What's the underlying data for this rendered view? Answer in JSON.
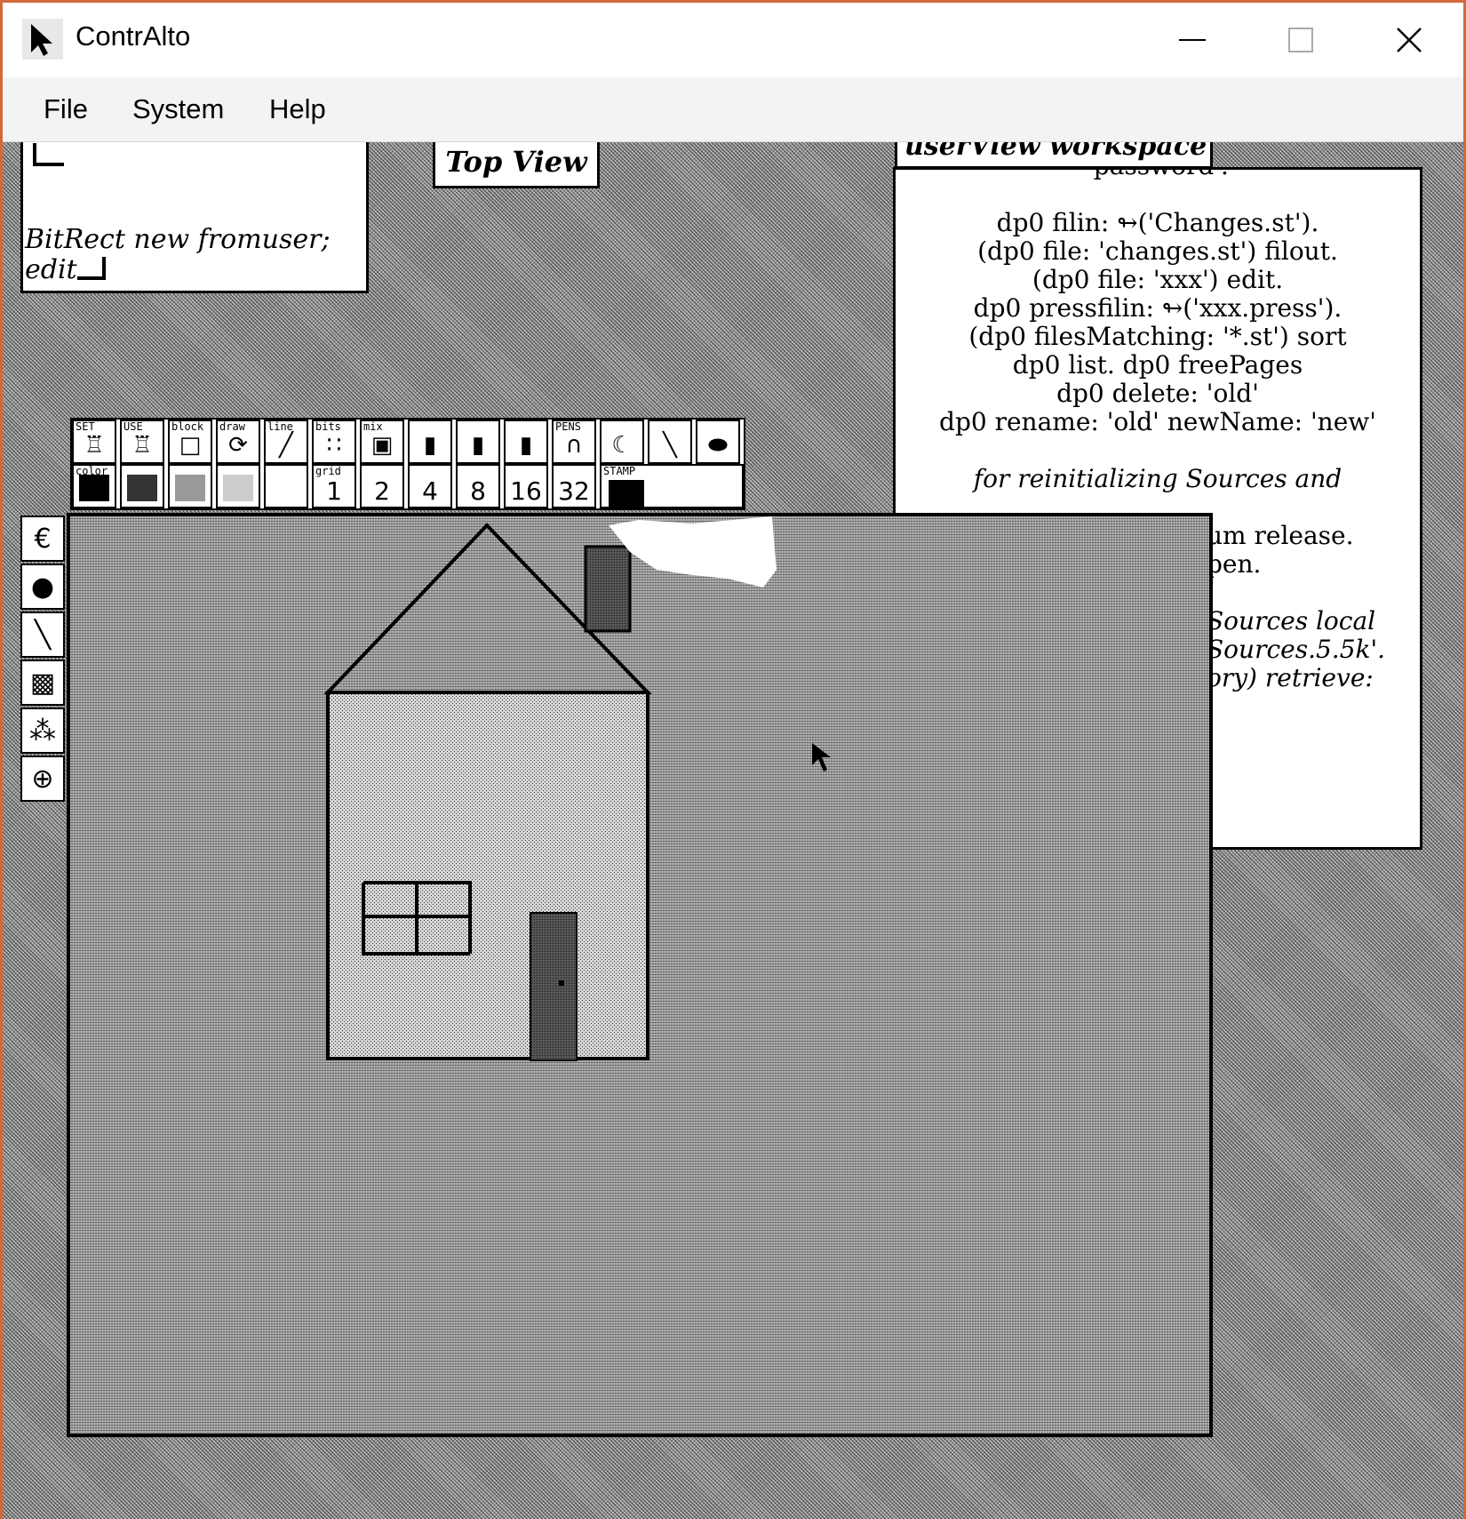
{
  "window": {
    "title": "ContrAlto",
    "border_color": "#d2693a"
  },
  "menu": {
    "items": [
      "File",
      "System",
      "Help"
    ]
  },
  "alto": {
    "small_window": {
      "line1": "BitRect new fromuser;",
      "line2": "edit"
    },
    "top_view_label": "Top View",
    "workspace": {
      "title": "userView workspace",
      "lines": [
        "'password'.",
        "",
        "dp0 filin: ↬('Changes.st').",
        "(dp0 file: 'changes.st') filout.",
        "(dp0 file: 'xxx') edit.",
        "dp0 pressfilin: ↬('xxx.press').",
        "(dp0 filesMatching: '*.st') sort",
        "dp0 list. dp0 freePages",
        "dp0 delete: 'old'",
        "dp0 rename: 'old' newName: 'new'",
        "",
        "for reinitializing Sources and"
      ],
      "partial_lines": [
        "um release.",
        "pen.",
        "",
        "Sources local",
        "Sources.5.5k'.",
        "ory) retrieve:"
      ]
    },
    "toolbar": {
      "top_labels": [
        "SET",
        "USE",
        "block",
        "draw",
        "line",
        "bits",
        "mix",
        "",
        "",
        "",
        "PENS",
        "",
        "",
        ""
      ],
      "grid_label": "grid",
      "grid_values": [
        "1",
        "2",
        "4",
        "8",
        "16",
        "32"
      ],
      "color_label": "color",
      "stamp_label": "STAMP"
    },
    "side_tools": [
      "curve-tool-icon",
      "fill-circle-icon",
      "line-tool-icon",
      "gray-tool-icon",
      "sparkle-tool-icon",
      "magnify-tool-icon"
    ]
  }
}
